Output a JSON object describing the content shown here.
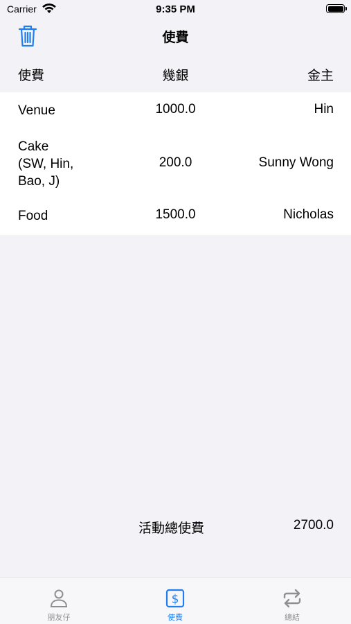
{
  "status": {
    "carrier": "Carrier",
    "time": "9:35 PM"
  },
  "nav": {
    "title": "使費"
  },
  "columns": {
    "item": "使費",
    "amount": "幾銀",
    "payer": "金主"
  },
  "expenses": [
    {
      "item": "Venue",
      "amount": "1000.0",
      "payer": "Hin"
    },
    {
      "item": "Cake\n(SW, Hin,\nBao, J)",
      "amount": "200.0",
      "payer": "Sunny Wong"
    },
    {
      "item": "Food",
      "amount": "1500.0",
      "payer": "Nicholas"
    }
  ],
  "total": {
    "label": "活動總使費",
    "value": "2700.0"
  },
  "tabs": [
    {
      "label": "朋友仔",
      "icon": "person-icon",
      "active": false
    },
    {
      "label": "使費",
      "icon": "dollar-sign-icon",
      "active": true
    },
    {
      "label": "總結",
      "icon": "repeat-arrows-icon",
      "active": false
    }
  ],
  "colors": {
    "accent": "#1f7ff0",
    "inactive": "#8e8e93",
    "background": "#f2f2f7"
  }
}
